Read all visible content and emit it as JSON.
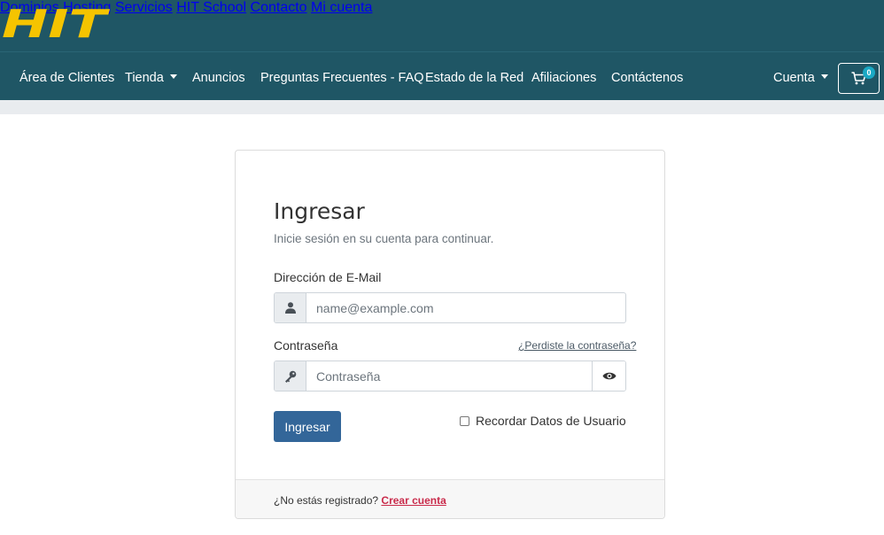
{
  "brand": {
    "logo_text": "HIT",
    "logo_color": "#f5c400",
    "header_bg": "#1f5665"
  },
  "top_nav": [
    "Dominios",
    "Hosting",
    "Servicios",
    "HIT School",
    "Contacto",
    "Mi cuenta"
  ],
  "main_nav": {
    "items": [
      {
        "label": "Área de Clientes",
        "dropdown": false
      },
      {
        "label": "Tienda",
        "dropdown": true
      },
      {
        "label": "Anuncios",
        "dropdown": false
      },
      {
        "label": "Preguntas Frecuentes - FAQ",
        "dropdown": false
      },
      {
        "label": "Estado de la Red",
        "dropdown": false
      },
      {
        "label": "Afiliaciones",
        "dropdown": false
      },
      {
        "label": "Contáctenos",
        "dropdown": false
      }
    ],
    "account_label": "Cuenta",
    "cart_count": "0",
    "cart_icon": "shopping-cart-icon"
  },
  "login": {
    "title": "Ingresar",
    "subtitle": "Inicie sesión en su cuenta para continuar.",
    "email_label": "Dirección de E-Mail",
    "email_placeholder": "name@example.com",
    "email_value": "",
    "password_label": "Contraseña",
    "forgot_label": "¿Perdiste la contraseña?",
    "password_placeholder": "Contraseña",
    "password_value": "",
    "submit_label": "Ingresar",
    "submit_color": "#336699",
    "remember_label": "Recordar Datos de Usuario",
    "remember_checked": false,
    "footer_text": "¿No estás registrado?",
    "footer_link": "Crear cuenta",
    "footer_link_color": "#c92a4a"
  }
}
